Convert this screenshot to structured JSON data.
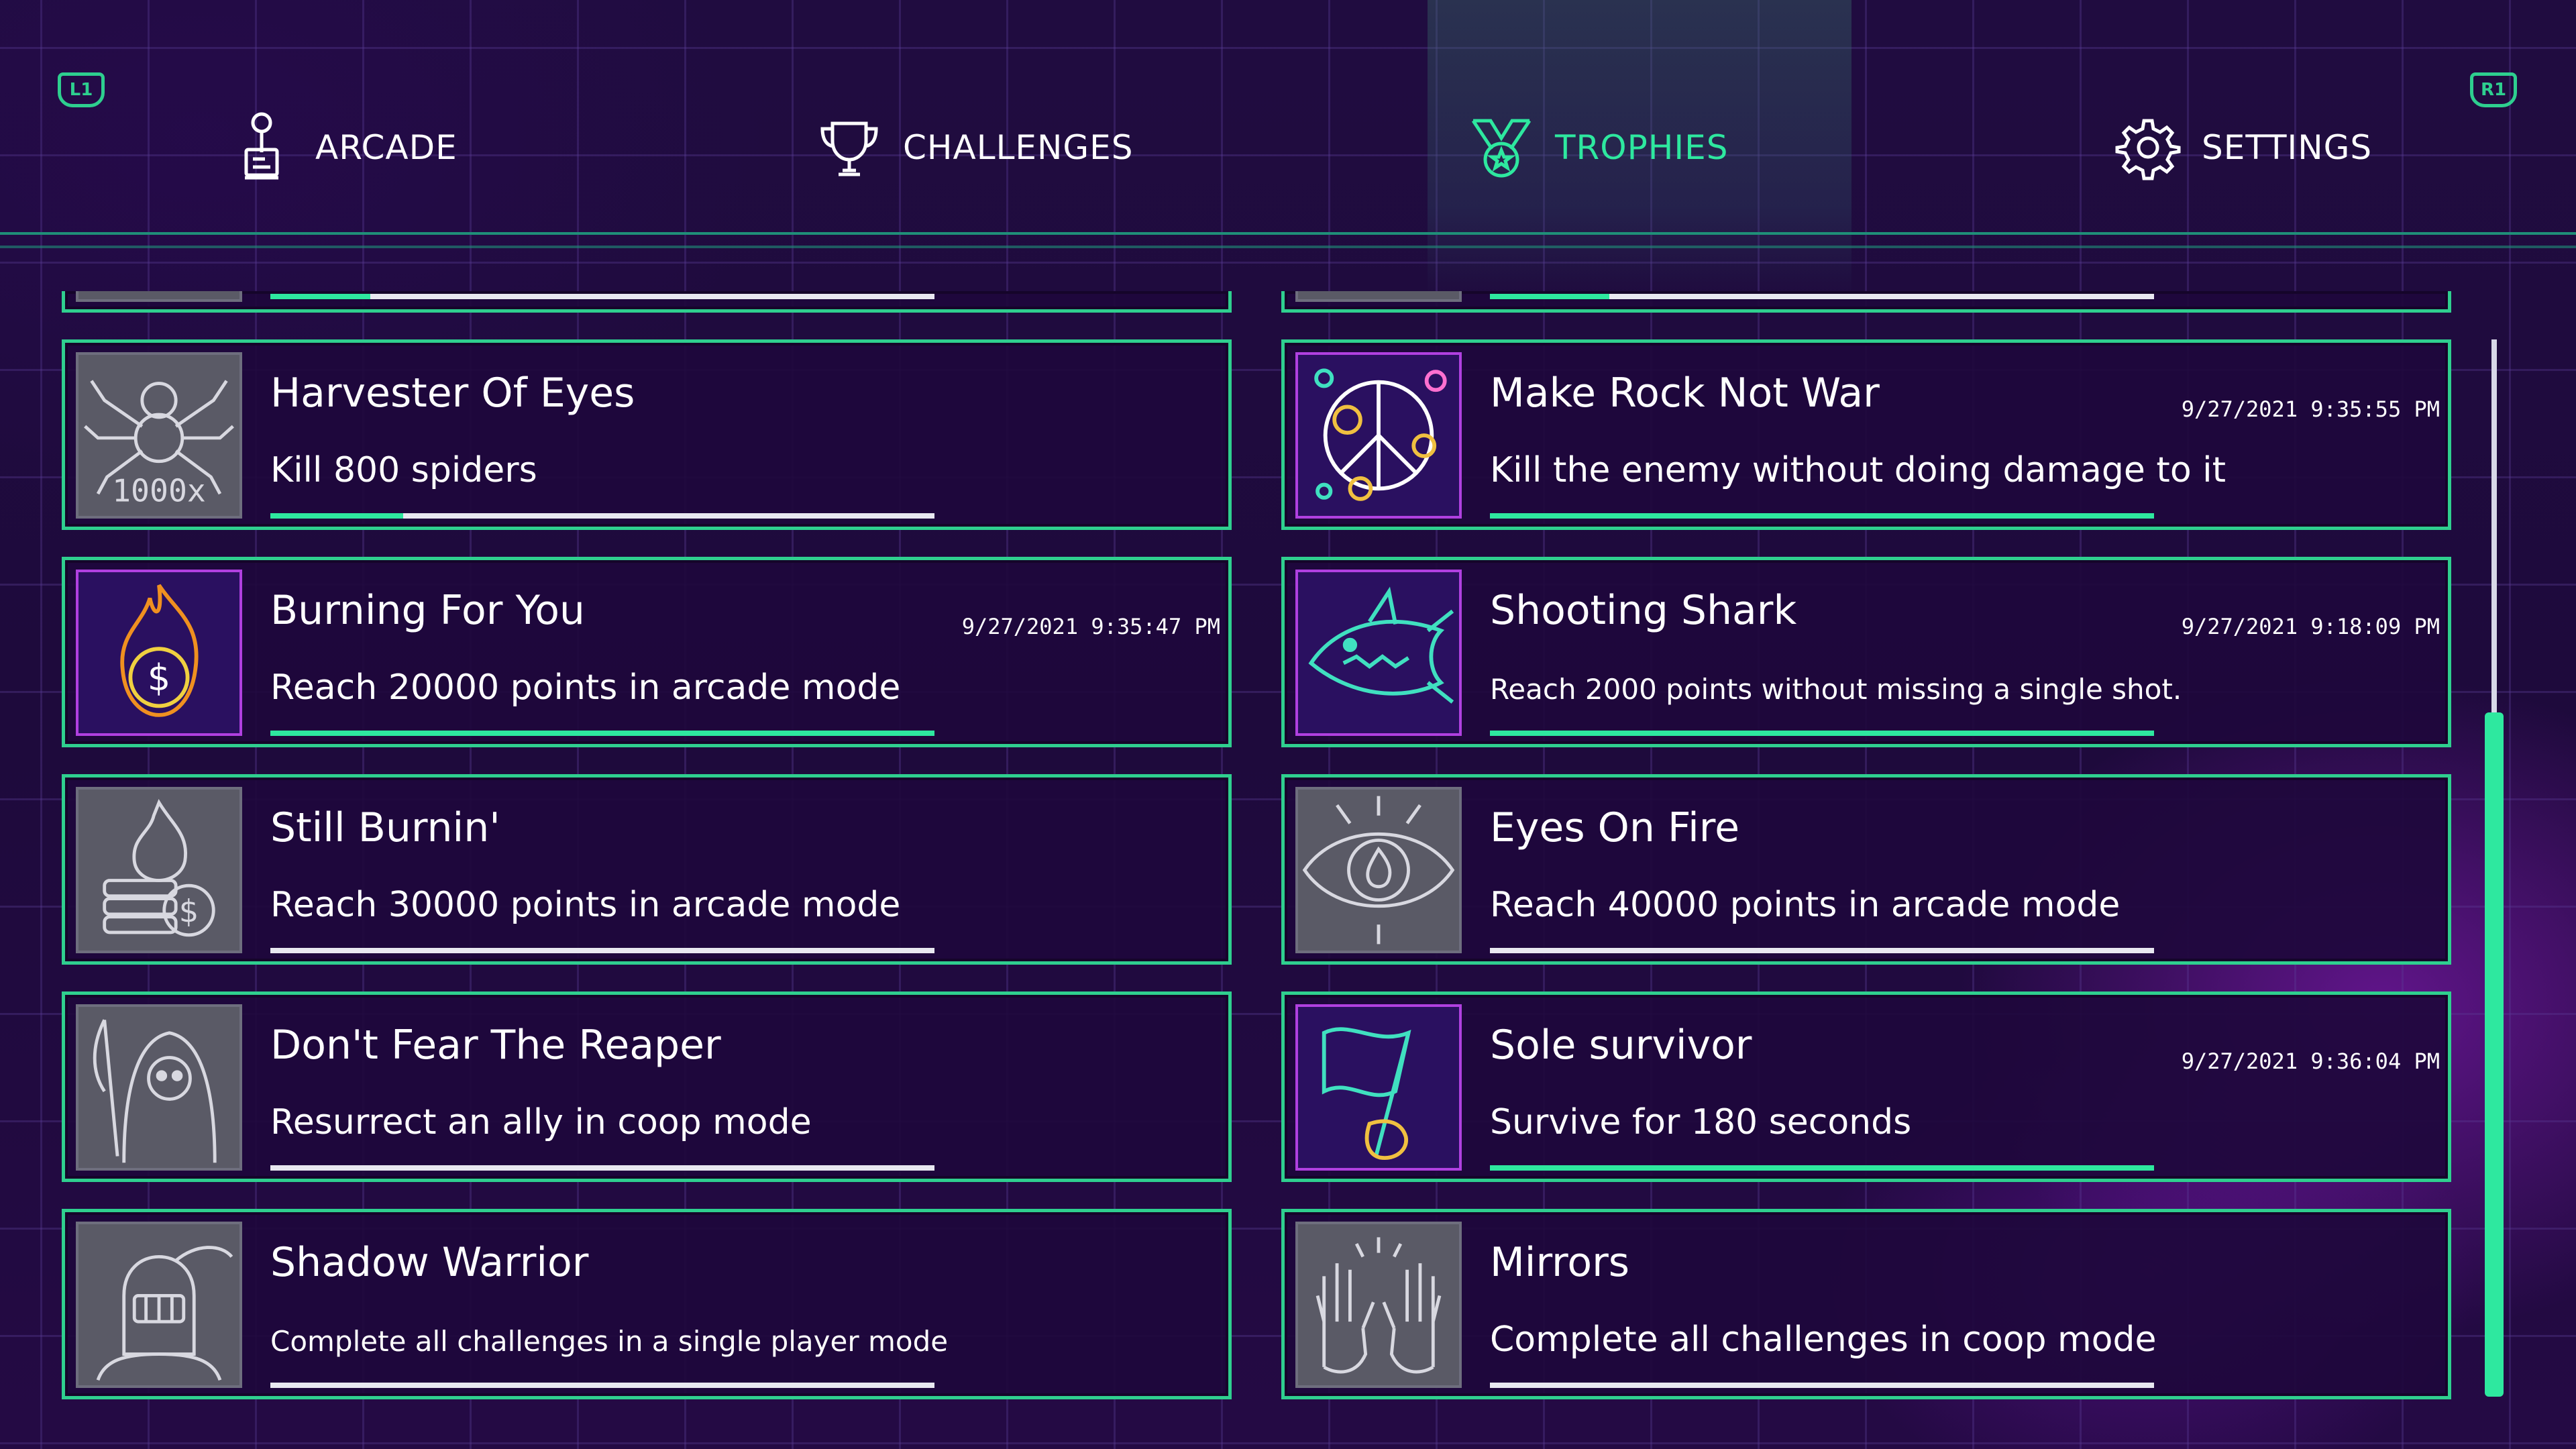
{
  "header": {
    "shoulder_left": "L1",
    "shoulder_right": "R1",
    "tabs": [
      {
        "label": "ARCADE",
        "icon": "joystick-icon",
        "active": false
      },
      {
        "label": "CHALLENGES",
        "icon": "trophy-cup-icon",
        "active": false
      },
      {
        "label": "TROPHIES",
        "icon": "medal-icon",
        "active": true
      },
      {
        "label": "SETTINGS",
        "icon": "gear-icon",
        "active": false
      }
    ]
  },
  "colors": {
    "accent": "#2ee89f",
    "border": "#2fcf8f",
    "card_bg": "#1e083c",
    "unlocked_frame": "#b040e0",
    "locked_icon": "#5a5a66"
  },
  "trophies": [
    {
      "title": "Harvester Of Eyes",
      "description": "Kill 800 spiders",
      "date": "",
      "progress": 0.2,
      "unlocked": false,
      "icon": "spider-icon",
      "icon_text": "1000x"
    },
    {
      "title": "Make Rock Not War",
      "description": "Kill the enemy without doing damage to it",
      "date": "9/27/2021 9:35:55 PM",
      "progress": 1.0,
      "unlocked": true,
      "icon": "peace-sign-icon"
    },
    {
      "title": "Burning For You",
      "description": "Reach 20000 points in arcade mode",
      "date": "9/27/2021 9:35:47 PM",
      "progress": 1.0,
      "unlocked": true,
      "icon": "flaming-coin-icon"
    },
    {
      "title": "Shooting Shark",
      "description": "Reach 2000 points without missing a single shot.",
      "date": "9/27/2021 9:18:09 PM",
      "progress": 1.0,
      "unlocked": true,
      "icon": "shark-icon"
    },
    {
      "title": "Still Burnin'",
      "description": "Reach 30000 points in arcade mode",
      "date": "",
      "progress": 0.0,
      "unlocked": false,
      "icon": "burning-coins-icon"
    },
    {
      "title": "Eyes On Fire",
      "description": "Reach 40000 points in arcade mode",
      "date": "",
      "progress": 0.0,
      "unlocked": false,
      "icon": "fiery-eye-icon"
    },
    {
      "title": "Don't Fear The Reaper",
      "description": "Resurrect an ally in coop mode",
      "date": "",
      "progress": 0.0,
      "unlocked": false,
      "icon": "reaper-icon"
    },
    {
      "title": "Sole survivor",
      "description": "Survive for 180 seconds",
      "date": "9/27/2021 9:36:04 PM",
      "progress": 1.0,
      "unlocked": true,
      "icon": "flag-hand-icon"
    },
    {
      "title": "Shadow Warrior",
      "description": "Complete all challenges in a single player mode",
      "date": "",
      "progress": 0.0,
      "unlocked": false,
      "icon": "knight-helmet-icon"
    },
    {
      "title": "Mirrors",
      "description": "Complete all challenges in coop mode",
      "date": "",
      "progress": 0.0,
      "unlocked": false,
      "icon": "raised-hands-icon"
    }
  ],
  "partial_rows": [
    {
      "progress": 0.15
    },
    {
      "progress": 0.18
    }
  ],
  "scroll": {
    "position": 0.35,
    "visible_fraction": 0.65
  }
}
